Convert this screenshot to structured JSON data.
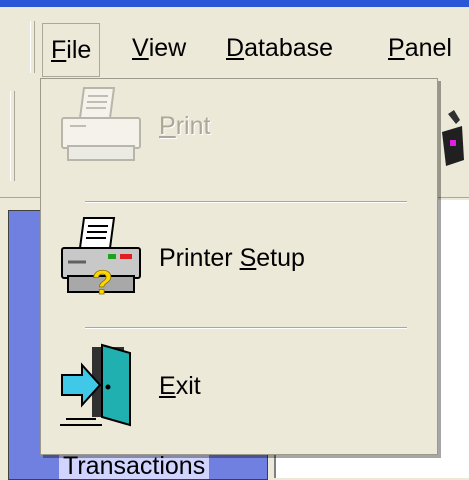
{
  "menubar": {
    "items": [
      {
        "label": "File",
        "underline": "F",
        "rest": "ile"
      },
      {
        "label": "View",
        "underline": "V",
        "rest": "iew"
      },
      {
        "label": "Database",
        "underline": "D",
        "rest": "atabase"
      },
      {
        "label": "Panel",
        "underline": "P",
        "rest": "anel"
      }
    ]
  },
  "file_menu": {
    "items": [
      {
        "label": "Print",
        "before": "",
        "underline": "P",
        "after": "rint",
        "enabled": false,
        "icon": "printer-icon"
      },
      {
        "label": "Printer Setup",
        "before": "Printer ",
        "underline": "S",
        "after": "etup",
        "enabled": true,
        "icon": "printer-setup-icon"
      },
      {
        "label": "Exit",
        "before": "",
        "underline": "E",
        "after": "xit",
        "enabled": true,
        "icon": "exit-door-icon"
      }
    ]
  },
  "left_panel": {
    "label": "Transactions"
  },
  "colors": {
    "title_bar": "#2a56d8",
    "menu_bg": "#ece9d8",
    "panel_blue": "#7080e0"
  }
}
